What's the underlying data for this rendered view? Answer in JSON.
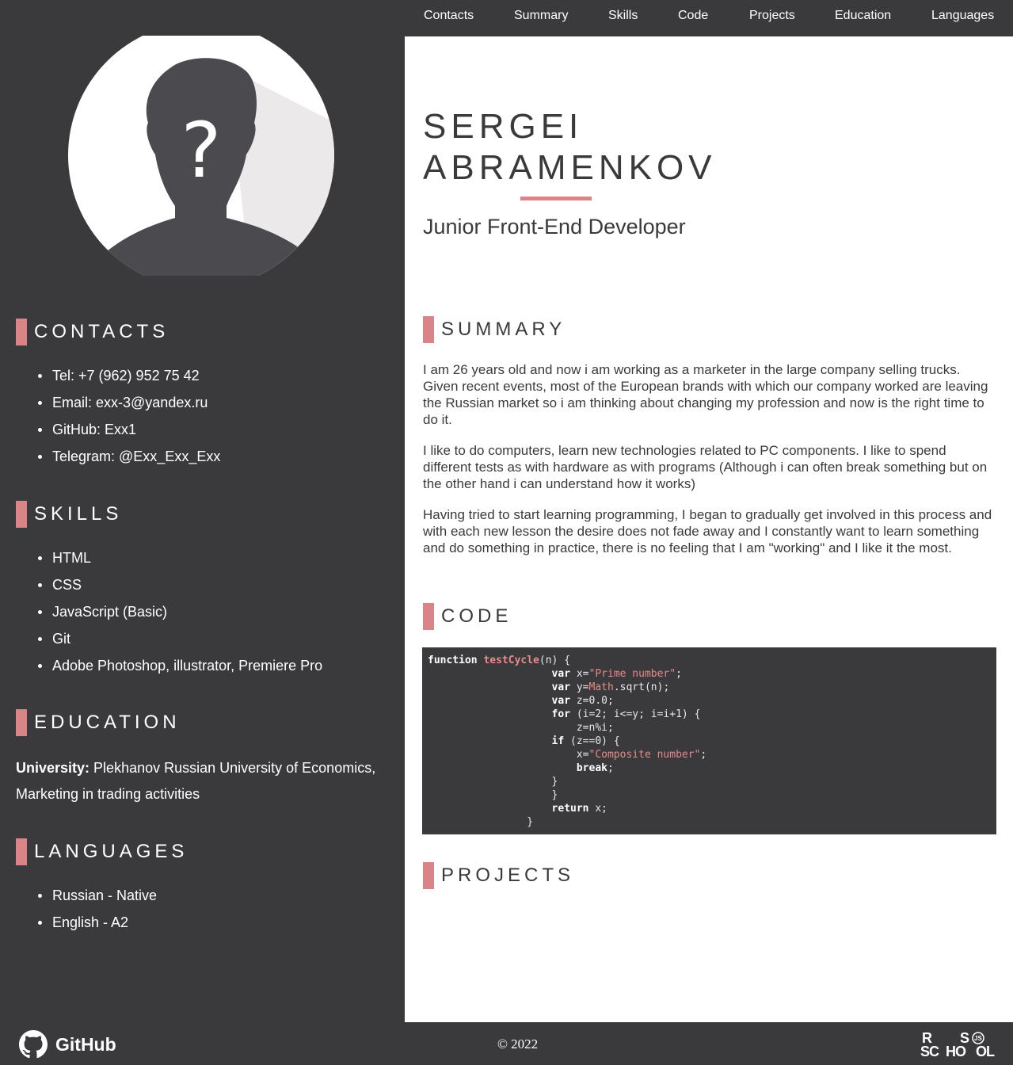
{
  "nav": {
    "items": [
      {
        "label": "Contacts"
      },
      {
        "label": "Summary"
      },
      {
        "label": "Skills"
      },
      {
        "label": "Code"
      },
      {
        "label": "Projects"
      },
      {
        "label": "Education"
      },
      {
        "label": "Languages"
      }
    ]
  },
  "profile": {
    "name_line1": "SERGEI",
    "name_line2": "ABRAMENKOV",
    "role": "Junior Front-End Developer"
  },
  "sidebar": {
    "contacts": {
      "heading": "CONTACTS",
      "items": [
        "Tel: +7 (962) 952 75 42",
        "Email: exx-3@yandex.ru",
        "GitHub: Exx1",
        "Telegram: @Exx_Exx_Exx"
      ]
    },
    "skills": {
      "heading": "SKILLS",
      "items": [
        "HTML",
        "CSS",
        "JavaScript (Basic)",
        "Git",
        "Adobe Photoshop, illustrator, Premiere Pro"
      ]
    },
    "education": {
      "heading": "EDUCATION",
      "label": "University:",
      "text": " Plekhanov Russian University of Economics, Marketing in trading activities"
    },
    "languages": {
      "heading": "LANGUAGES",
      "items": [
        "Russian - Native",
        "English - A2"
      ]
    }
  },
  "summary": {
    "heading": "SUMMARY",
    "paragraphs": [
      "I am 26 years old and now i am working as a marketer in the large company selling trucks. Given recent events, most of the European brands with which our company worked are leaving the Russian market so i am thinking about changing my profession and now is the right time to do it.",
      "I like to do computers, learn new technologies related to PC components. I like to spend different tests as with hardware as with programs (Although i can often break something but on the other hand i can understand how it works)",
      "Having tried to start learning programming, I began to gradually get involved in this process and with each new lesson the desire does not fade away and I constantly want to learn something and do something in practice, there is no feeling that I am \"working\" and I like it the most."
    ]
  },
  "code": {
    "heading": "CODE"
  },
  "projects": {
    "heading": "PROJECTS"
  },
  "footer": {
    "github_label": "GitHub",
    "copyright": "© 2022",
    "school_logo_text": "RS SCHOOL JS"
  },
  "colors": {
    "dark_bg": "#3a3a3c",
    "accent": "#d98486",
    "white": "#ffffff"
  }
}
